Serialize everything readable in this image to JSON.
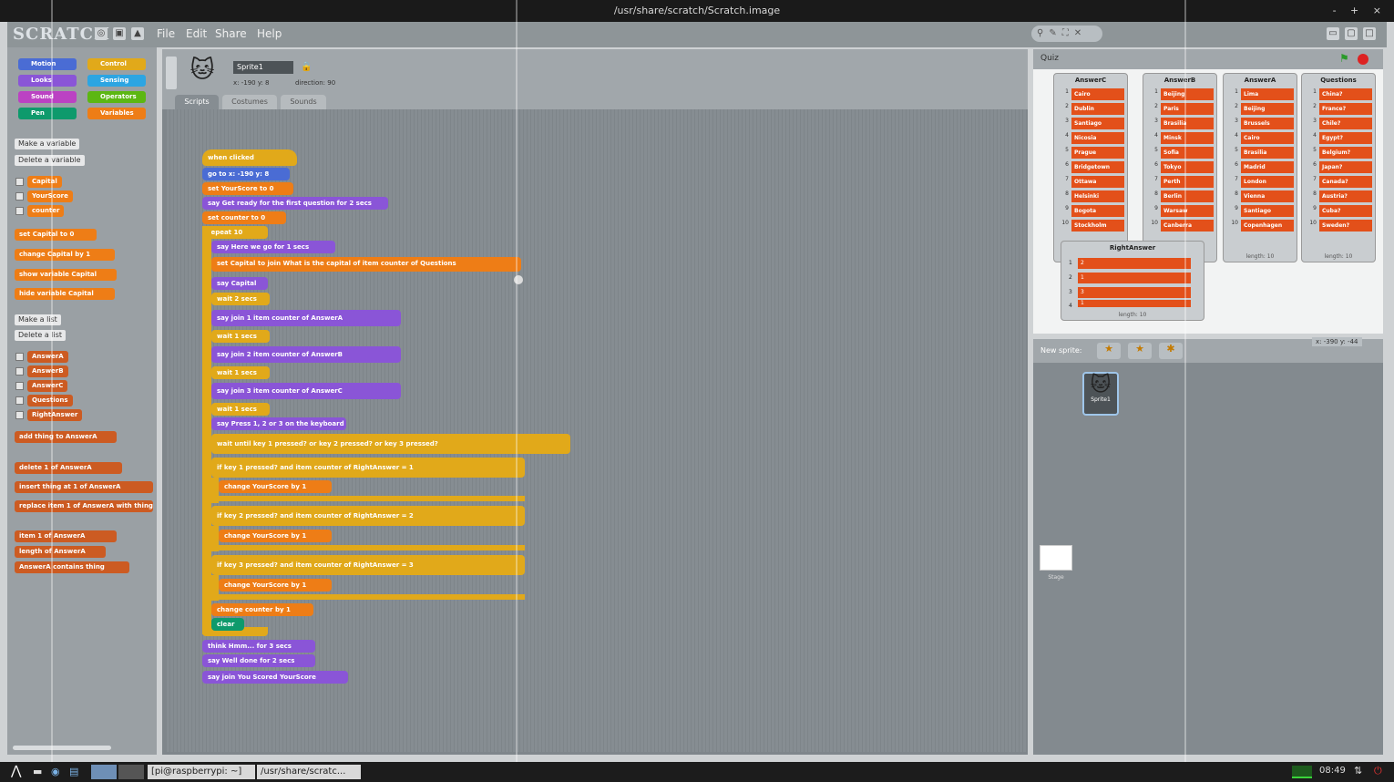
{
  "window": {
    "title": "/usr/share/scratch/Scratch.image",
    "controls": "- + ×"
  },
  "app": {
    "logo": "SCRATCH",
    "menus": [
      "File",
      "Edit",
      "Share",
      "Help"
    ]
  },
  "palette": {
    "categories": [
      "Motion",
      "Looks",
      "Sound",
      "Pen",
      "Control",
      "Sensing",
      "Operators",
      "Variables"
    ],
    "make_variable": "Make a variable",
    "delete_variable": "Delete a variable",
    "variables": [
      "Capital",
      "YourScore",
      "counter"
    ],
    "var_blocks": [
      "set Capital to 0",
      "change Capital by 1",
      "show variable Capital",
      "hide variable Capital"
    ],
    "make_list": "Make a list",
    "delete_list": "Delete a list",
    "lists": [
      "AnswerA",
      "AnswerB",
      "AnswerC",
      "Questions",
      "RightAnswer"
    ],
    "list_blocks": [
      "add thing to AnswerA",
      "delete 1 of AnswerA",
      "insert thing at 1 of AnswerA",
      "replace item 1 of AnswerA with thing",
      "item 1 of AnswerA",
      "length of AnswerA",
      "AnswerA contains thing"
    ]
  },
  "sprite": {
    "name": "Sprite1",
    "pos": "x: -190 y: 8",
    "direction": "direction: 90"
  },
  "tabs": [
    "Scripts",
    "Costumes",
    "Sounds"
  ],
  "script": {
    "hat": "when clicked",
    "l1": "go to x: -190 y: 8",
    "l2": "set YourScore to 0",
    "l3": "say Get ready for the first question for 2 secs",
    "l4": "set counter to 0",
    "l5": "repeat 10",
    "l6": "say Here we go for 1 secs",
    "l7": "set Capital to join What is the capital of item counter of Questions",
    "l8": "say Capital",
    "l9": "wait 2 secs",
    "l10": "say join 1 item counter of AnswerA",
    "l11": "wait 1 secs",
    "l12": "say join 2 item counter of AnswerB",
    "l13": "wait 1 secs",
    "l14": "say join 3 item counter of AnswerC",
    "l15": "wait 1 secs",
    "l16": "say Press 1, 2 or 3 on the keyboard",
    "l17": "wait until key 1 pressed? or key 2 pressed? or key 3 pressed?",
    "l18": "if key 1 pressed? and item counter of RightAnswer = 1",
    "l19": "change YourScore by 1",
    "l20": "if key 2 pressed? and item counter of RightAnswer = 2",
    "l21": "change YourScore by 1",
    "l22": "if key 3 pressed? and item counter of RightAnswer = 3",
    "l23": "change YourScore by 1",
    "l24": "change counter by 1",
    "l25": "clear",
    "l26": "think Hmm... for 3 secs",
    "l27": "say Well done for 2 secs",
    "l28": "say join You Scored YourScore"
  },
  "stage": {
    "title": "Quiz",
    "coords": "x: -390  y: -44"
  },
  "lists": {
    "AnswerC": [
      "Cairo",
      "Dublin",
      "Santiago",
      "Nicosia",
      "Prague",
      "Bridgetown",
      "Ottawa",
      "Helsinki",
      "Bogota",
      "Stockholm"
    ],
    "AnswerB": [
      "Beijing",
      "Paris",
      "Brasilia",
      "Minsk",
      "Sofia",
      "Tokyo",
      "Perth",
      "Berlin",
      "Warsaw",
      "Canberra"
    ],
    "AnswerA": [
      "Lima",
      "Beijing",
      "Brussels",
      "Cairo",
      "Brasilia",
      "Madrid",
      "London",
      "Vienna",
      "Santiago",
      "Copenhagen"
    ],
    "Questions": [
      "China?",
      "France?",
      "Chile?",
      "Egypt?",
      "Belgium?",
      "Japan?",
      "Canada?",
      "Austria?",
      "Cuba?",
      "Sweden?"
    ],
    "RightAnswer": [
      "2",
      "1",
      "3",
      "1"
    ],
    "len": "length: 10"
  },
  "sprites": {
    "new_label": "New sprite:",
    "sprite1": "Sprite1",
    "stage": "Stage"
  },
  "taskbar": {
    "terminal": "[pi@raspberrypi: ~]",
    "scratch": "/usr/share/scratc...",
    "clock": "08:49"
  }
}
